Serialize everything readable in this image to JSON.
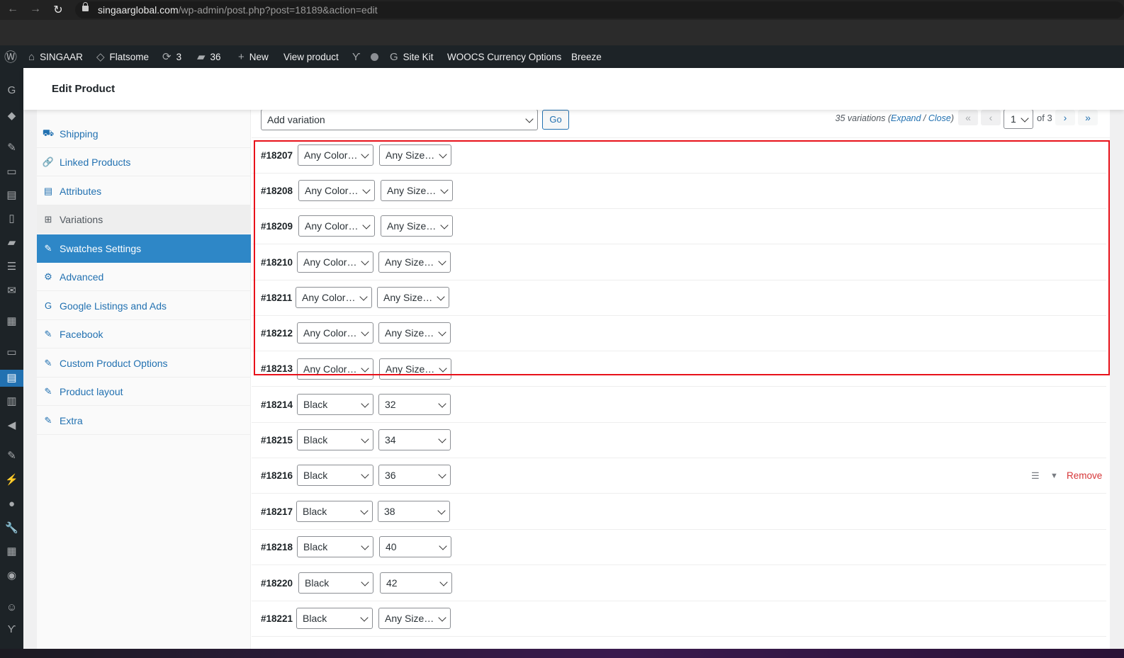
{
  "browser": {
    "url_host": "singaarglobal.com",
    "url_path": "/wp-admin/post.php?post=18189&action=edit"
  },
  "adminbar": {
    "site": "SINGAAR",
    "theme": "Flatsome",
    "updates": "3",
    "comments": "36",
    "new": "New",
    "view": "View product",
    "sitekit": "Site Kit",
    "woocs": "WOOCS Currency Options",
    "breeze": "Breeze"
  },
  "header": {
    "title": "Edit Product"
  },
  "tabs": [
    {
      "label": "Shipping",
      "icon": "truck-icon"
    },
    {
      "label": "Linked Products",
      "icon": "link-icon"
    },
    {
      "label": "Attributes",
      "icon": "list-icon"
    },
    {
      "label": "Variations",
      "icon": "grid-icon"
    },
    {
      "label": "Swatches Settings",
      "icon": "wrench-icon"
    },
    {
      "label": "Advanced",
      "icon": "gear-icon"
    },
    {
      "label": "Google Listings and Ads",
      "icon": "google-icon"
    },
    {
      "label": "Facebook",
      "icon": "wrench-icon"
    },
    {
      "label": "Custom Product Options",
      "icon": "wrench-icon"
    },
    {
      "label": "Product layout",
      "icon": "wrench-icon"
    },
    {
      "label": "Extra",
      "icon": "wrench-icon"
    }
  ],
  "toolbar": {
    "add_variation": "Add variation",
    "go": "Go",
    "count_text": "35 variations (",
    "expand": "Expand",
    "slash": " / ",
    "close": "Close",
    "close_paren": ")",
    "first": "«",
    "prev": "‹",
    "page": "1",
    "of_text": "of 3",
    "next": "›",
    "last": "»"
  },
  "variations": [
    {
      "id": "#18207",
      "color": "Any Color…",
      "size": "Any Size…"
    },
    {
      "id": "#18208",
      "color": "Any Color…",
      "size": "Any Size…"
    },
    {
      "id": "#18209",
      "color": "Any Color…",
      "size": "Any Size…"
    },
    {
      "id": "#18210",
      "color": "Any Color…",
      "size": "Any Size…"
    },
    {
      "id": "#18211",
      "color": "Any Color…",
      "size": "Any Size…"
    },
    {
      "id": "#18212",
      "color": "Any Color…",
      "size": "Any Size…"
    },
    {
      "id": "#18213",
      "color": "Any Color…",
      "size": "Any Size…"
    },
    {
      "id": "#18214",
      "color": "Black",
      "size": "32"
    },
    {
      "id": "#18215",
      "color": "Black",
      "size": "34"
    },
    {
      "id": "#18216",
      "color": "Black",
      "size": "36"
    },
    {
      "id": "#18217",
      "color": "Black",
      "size": "38"
    },
    {
      "id": "#18218",
      "color": "Black",
      "size": "40"
    },
    {
      "id": "#18220",
      "color": "Black",
      "size": "42"
    },
    {
      "id": "#18221",
      "color": "Black",
      "size": "Any Size…"
    }
  ],
  "hover_row": {
    "remove": "Remove"
  },
  "colors": {
    "accent": "#2271b1",
    "active_tab": "#2e87c7",
    "highlight": "#e8111a",
    "remove": "#d63638"
  }
}
